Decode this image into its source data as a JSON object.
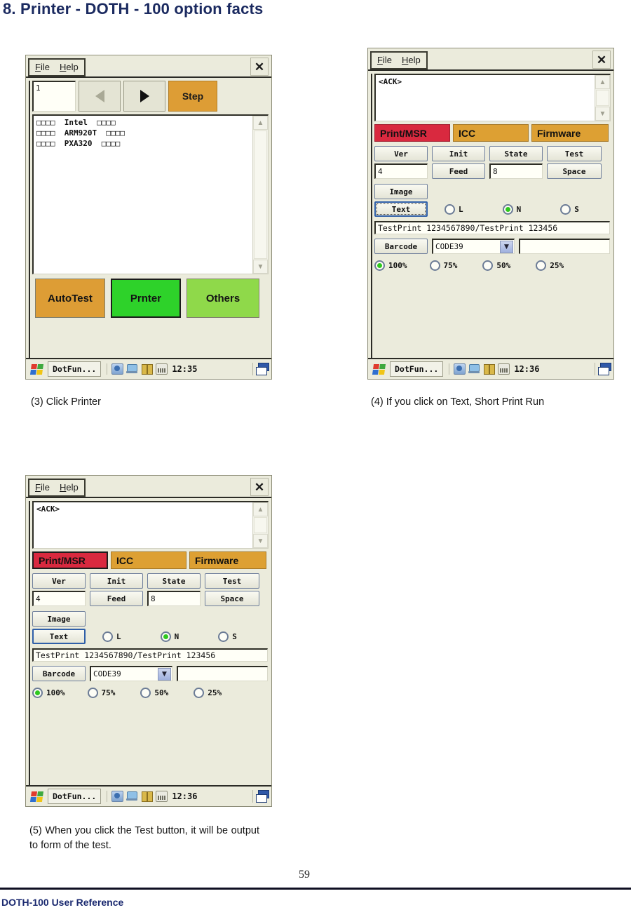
{
  "page": {
    "title": "8. Printer - DOTH - 100 option facts",
    "number": "59",
    "footer": "DOTH-100 User Reference"
  },
  "menu": {
    "file": "File",
    "help": "Help",
    "close_icon": "close-icon"
  },
  "panel1": {
    "step_value": "1",
    "prev_label": "prev-arrow",
    "next_label": "next-arrow",
    "step_button": "Step",
    "log_lines": [
      "□□□□  Intel  □□□□",
      "□□□□  ARM920T  □□□□",
      "□□□□  PXA320  □□□□"
    ],
    "buttons": [
      {
        "label": "AutoTest",
        "color": "#dd9d35"
      },
      {
        "label": "Prnter",
        "color": "#2ed22a"
      },
      {
        "label": "Others",
        "color": "#8fd94a"
      }
    ],
    "taskbar": {
      "app": "DotFun...",
      "clock": "12:35"
    }
  },
  "panel2": {
    "log_lines": [
      "<ACK>"
    ],
    "tabs": [
      {
        "label": "Print/MSR",
        "color": "#d9293f",
        "selected": true
      },
      {
        "label": "ICC",
        "color": "#dda033",
        "selected": false
      },
      {
        "label": "Firmware",
        "color": "#dda033",
        "selected": false
      }
    ],
    "grid_row1": [
      "Ver",
      "Init",
      "State",
      "Test"
    ],
    "feed_value": "4",
    "feed_button": "Feed",
    "space_value": "8",
    "space_button": "Space",
    "image_button": "Image",
    "text_button": "Text",
    "text_button_state": "focused",
    "size_radios": [
      {
        "label": "L",
        "selected": false
      },
      {
        "label": "N",
        "selected": true
      },
      {
        "label": "S",
        "selected": false
      }
    ],
    "test_string": "TestPrint 1234567890/TestPrint 123456",
    "barcode_button": "Barcode",
    "barcode_type": "CODE39",
    "barcode_value": "",
    "scale_radios": [
      {
        "label": "100%",
        "selected": true
      },
      {
        "label": "75%",
        "selected": false
      },
      {
        "label": "50%",
        "selected": false
      },
      {
        "label": "25%",
        "selected": false
      }
    ],
    "taskbar": {
      "app": "DotFun...",
      "clock": "12:36"
    }
  },
  "panel3": {
    "log_lines": [
      "<ACK>"
    ],
    "tabs": [
      {
        "label": "Print/MSR",
        "color": "#d9293f",
        "selected": true
      },
      {
        "label": "ICC",
        "color": "#dda033",
        "selected": false
      },
      {
        "label": "Firmware",
        "color": "#dda033",
        "selected": false
      }
    ],
    "grid_row1": [
      "Ver",
      "Init",
      "State",
      "Test"
    ],
    "feed_value": "4",
    "feed_button": "Feed",
    "space_value": "8",
    "space_button": "Space",
    "image_button": "Image",
    "text_button": "Text",
    "text_button_state": "selected",
    "size_radios": [
      {
        "label": "L",
        "selected": false
      },
      {
        "label": "N",
        "selected": true
      },
      {
        "label": "S",
        "selected": false
      }
    ],
    "test_string": "TestPrint 1234567890/TestPrint 123456",
    "barcode_button": "Barcode",
    "barcode_type": "CODE39",
    "barcode_value": "",
    "scale_radios": [
      {
        "label": "100%",
        "selected": true
      },
      {
        "label": "75%",
        "selected": false
      },
      {
        "label": "50%",
        "selected": false
      },
      {
        "label": "25%",
        "selected": false
      }
    ],
    "taskbar": {
      "app": "DotFun...",
      "clock": "12:36"
    }
  },
  "captions": {
    "c3": "(3) Click Printer",
    "c4": "(4) If you click on Text, Short Print Run",
    "c5": "(5) When you click the Test button, it will be output to form of the test."
  }
}
